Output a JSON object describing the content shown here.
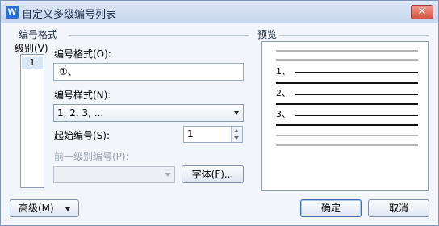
{
  "window": {
    "title": "自定义多级编号列表",
    "app_icon": "W",
    "close": "✕"
  },
  "numbering_group": {
    "title": "编号格式"
  },
  "levels": {
    "label": "级别(V)",
    "items": [
      "1"
    ],
    "selected": "1"
  },
  "format": {
    "label": "编号格式(O):",
    "value": "①、"
  },
  "style": {
    "label": "编号样式(N):",
    "value": "1, 2, 3, ..."
  },
  "start": {
    "label": "起始编号(S):",
    "value": "1"
  },
  "prev_level": {
    "label": "前一级别编号(P):",
    "value": ""
  },
  "font_button": "字体(F)...",
  "preview_group": {
    "title": "预览",
    "numbers": [
      "1、",
      "2、",
      "3、"
    ]
  },
  "footer": {
    "advanced": "高级(M)",
    "ok": "确定",
    "cancel": "取消"
  }
}
